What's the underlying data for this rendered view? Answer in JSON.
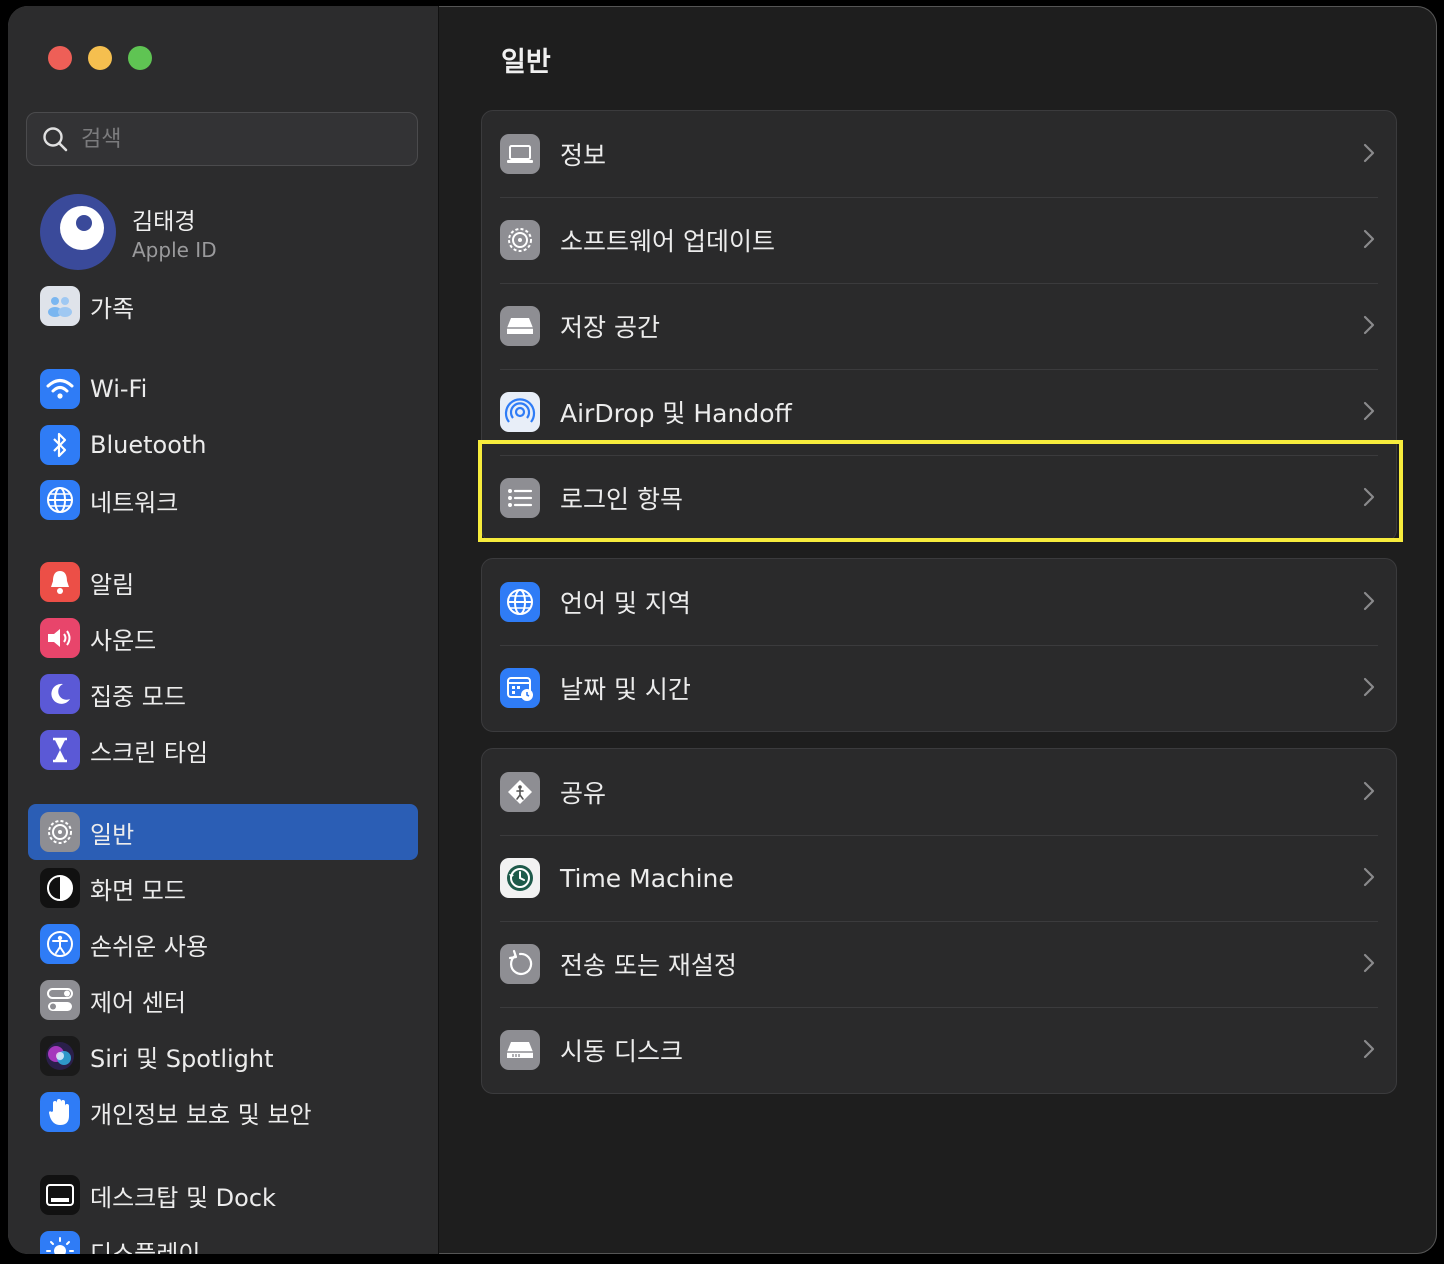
{
  "search": {
    "placeholder": "검색"
  },
  "account": {
    "name": "김태경",
    "subtitle": "Apple ID"
  },
  "sidebar": {
    "items": [
      {
        "label": "가족"
      },
      {
        "label": "Wi-Fi"
      },
      {
        "label": "Bluetooth"
      },
      {
        "label": "네트워크"
      },
      {
        "label": "알림"
      },
      {
        "label": "사운드"
      },
      {
        "label": "집중 모드"
      },
      {
        "label": "스크린 타임"
      },
      {
        "label": "일반"
      },
      {
        "label": "화면 모드"
      },
      {
        "label": "손쉬운 사용"
      },
      {
        "label": "제어 센터"
      },
      {
        "label": "Siri 및 Spotlight"
      },
      {
        "label": "개인정보 보호 및 보안"
      },
      {
        "label": "데스크탑 및 Dock"
      },
      {
        "label": "디스플레이"
      }
    ],
    "selected": "일반"
  },
  "main": {
    "title": "일반",
    "groups": [
      {
        "rows": [
          {
            "label": "정보"
          },
          {
            "label": "소프트웨어 업데이트"
          },
          {
            "label": "저장 공간"
          },
          {
            "label": "AirDrop 및 Handoff"
          },
          {
            "label": "로그인 항목"
          }
        ]
      },
      {
        "rows": [
          {
            "label": "언어 및 지역"
          },
          {
            "label": "날짜 및 시간"
          }
        ]
      },
      {
        "rows": [
          {
            "label": "공유"
          },
          {
            "label": "Time Machine"
          },
          {
            "label": "전송 또는 재설정"
          },
          {
            "label": "시동 디스크"
          }
        ]
      }
    ]
  },
  "colors": {
    "accent": "#2b5eb5",
    "highlight": "#f7ec3c"
  }
}
